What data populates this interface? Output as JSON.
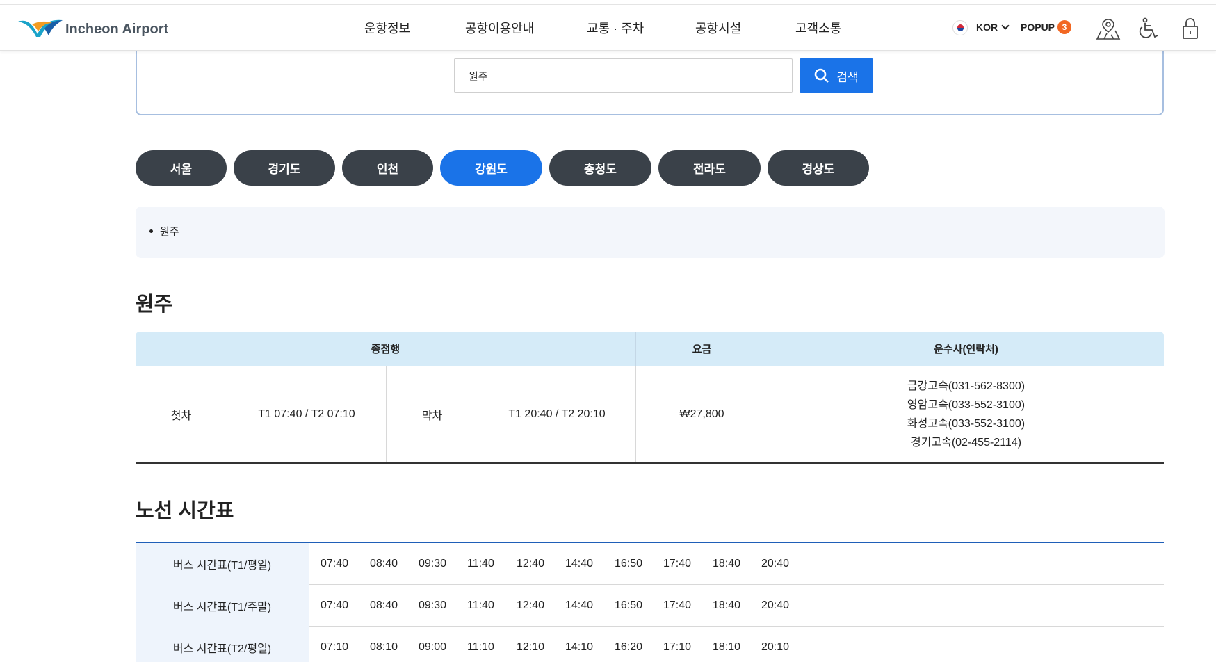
{
  "header": {
    "logo_text": "Incheon Airport",
    "nav": [
      "운항정보",
      "공항이용안내",
      "교통 · 주차",
      "공항시설",
      "고객소통"
    ],
    "lang": "KOR",
    "popup_label": "POPUP",
    "popup_count": "3"
  },
  "search": {
    "value": "원주",
    "button_label": "검색"
  },
  "regions": {
    "tabs": [
      "서울",
      "경기도",
      "인천",
      "강원도",
      "충청도",
      "전라도",
      "경상도"
    ],
    "active_index": 3,
    "active_color": "#1a73e8",
    "inactive_color": "#3a4149"
  },
  "breadcrumb": {
    "items": [
      "원주"
    ]
  },
  "route": {
    "title": "원주",
    "headers": {
      "terminal": "종점행",
      "fare": "요금",
      "carrier": "운수사(연락처)"
    },
    "first_label": "첫차",
    "first_time": "T1 07:40 / T2 07:10",
    "last_label": "막차",
    "last_time": "T1 20:40 / T2 20:10",
    "fare": "₩27,800",
    "carriers": [
      "금강고속(031-562-8300)",
      "영암고속(033-552-3100)",
      "화성고속(033-552-3100)",
      "경기고속(02-455-2114)"
    ]
  },
  "timetable": {
    "title": "노선 시간표",
    "rows": [
      {
        "label": "버스 시간표(T1/평일)",
        "times": [
          "07:40",
          "08:40",
          "09:30",
          "11:40",
          "12:40",
          "14:40",
          "16:50",
          "17:40",
          "18:40",
          "20:40"
        ]
      },
      {
        "label": "버스 시간표(T1/주말)",
        "times": [
          "07:40",
          "08:40",
          "09:30",
          "11:40",
          "12:40",
          "14:40",
          "16:50",
          "17:40",
          "18:40",
          "20:40"
        ]
      },
      {
        "label": "버스 시간표(T2/평일)",
        "times": [
          "07:10",
          "08:10",
          "09:00",
          "11:10",
          "12:10",
          "14:10",
          "16:20",
          "17:10",
          "18:10",
          "20:10"
        ]
      }
    ]
  }
}
